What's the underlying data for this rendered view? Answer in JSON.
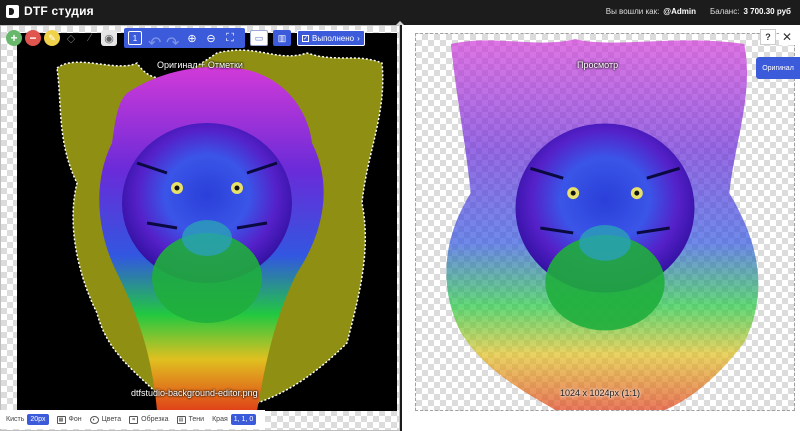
{
  "app": {
    "title": "DTF студия"
  },
  "account": {
    "logged_in_label": "Вы вошли как:",
    "username": "@Admin",
    "balance_label": "Баланс:",
    "balance_value": "3 700.30 руб"
  },
  "toolbar": {
    "tools": [
      {
        "icon": "add-circle-icon",
        "glyph": "+"
      },
      {
        "icon": "remove-circle-icon",
        "glyph": "−"
      },
      {
        "icon": "pencil-icon",
        "glyph": "/"
      },
      {
        "icon": "eraser-icon",
        "glyph": "◇"
      },
      {
        "icon": "brush-icon",
        "glyph": "✎"
      },
      {
        "icon": "sampler-icon",
        "glyph": "◉"
      }
    ],
    "brush_selector": "1",
    "done_label": "Выполнено",
    "accent": "#3b5bdb"
  },
  "left_panel": {
    "caption": "Оригинал + Отметки",
    "filename": "dtfstudio-background-editor.png"
  },
  "right_panel": {
    "caption": "Просмотр",
    "resolution": "1024 x 1024px (1:1)",
    "original_tab": "Оригинал",
    "help_label": "?",
    "close_label": "✕"
  },
  "bottom_bar": {
    "brush_label": "Кисть",
    "brush_value": "20px",
    "background_label": "Фон",
    "colors_label": "Цвета",
    "crop_label": "Обрезка",
    "shadows_label": "Тени",
    "edge_label": "Края",
    "edge_value": "1, 1, 0"
  }
}
